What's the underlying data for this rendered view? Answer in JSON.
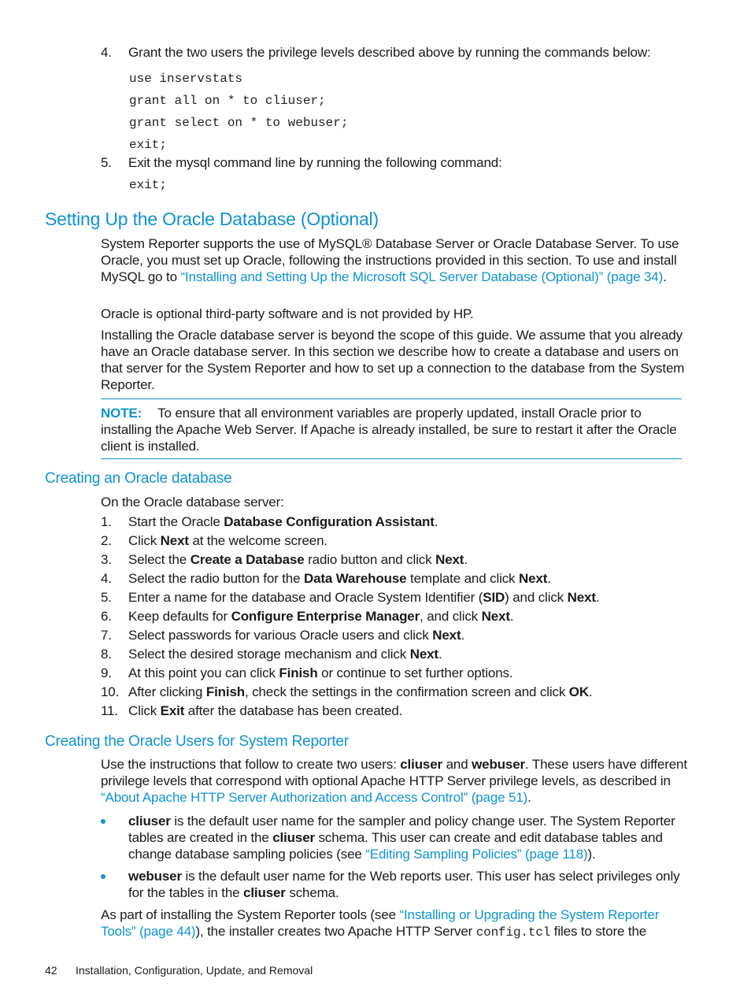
{
  "top_steps": [
    {
      "num": "4.",
      "text": "Grant the two users the privilege levels described above by running the commands below:"
    },
    {
      "num": "5.",
      "text": "Exit the mysql command line by running the following command:"
    }
  ],
  "grant_commands": [
    "use inservstats",
    "grant all on * to cliuser;",
    "grant select on * to webuser;",
    "exit;"
  ],
  "exit_command": "exit;",
  "section_oracle": {
    "title": "Setting Up the Oracle Database (Optional)",
    "intro_p1_a": "System Reporter supports the use of MySQL® Database Server or Oracle Database Server. To use Oracle, you must set up Oracle, following the instructions provided in this section. To use and install MySQL go to ",
    "intro_p1_link": "“Installing and Setting Up the Microsoft SQL Server Database (Optional)” (page 34)",
    "intro_p1_b": ".",
    "intro_p2": "Oracle is optional third-party software and is not provided by HP.",
    "intro_p3": "Installing the Oracle database server is beyond the scope of this guide. We assume that you already have an Oracle database server. In this section we describe how to create a database and users on that server for the System Reporter and how to set up a connection to the database from the System Reporter.",
    "note_label": "NOTE:",
    "note_text": "To ensure that all environment variables are properly updated, install Oracle prior to installing the Apache Web Server. If Apache is already installed, be sure to restart it after the Oracle client is installed."
  },
  "section_create_db": {
    "title": "Creating an Oracle database",
    "lead": "On the Oracle database server:",
    "steps": [
      {
        "num": "1.",
        "parts": [
          [
            "Start the Oracle ",
            false
          ],
          [
            "Database Configuration Assistant",
            true
          ],
          [
            ".",
            false
          ]
        ]
      },
      {
        "num": "2.",
        "parts": [
          [
            "Click ",
            false
          ],
          [
            "Next",
            true
          ],
          [
            " at the welcome screen.",
            false
          ]
        ]
      },
      {
        "num": "3.",
        "parts": [
          [
            "Select the ",
            false
          ],
          [
            "Create a Database",
            true
          ],
          [
            " radio button and click ",
            false
          ],
          [
            "Next",
            true
          ],
          [
            ".",
            false
          ]
        ]
      },
      {
        "num": "4.",
        "parts": [
          [
            "Select the radio button for the ",
            false
          ],
          [
            "Data Warehouse",
            true
          ],
          [
            " template and click ",
            false
          ],
          [
            "Next",
            true
          ],
          [
            ".",
            false
          ]
        ]
      },
      {
        "num": "5.",
        "parts": [
          [
            "Enter a name for the database and Oracle System Identifier (",
            false
          ],
          [
            "SID",
            true
          ],
          [
            ") and click ",
            false
          ],
          [
            "Next",
            true
          ],
          [
            ".",
            false
          ]
        ]
      },
      {
        "num": "6.",
        "parts": [
          [
            "Keep defaults for ",
            false
          ],
          [
            "Configure Enterprise Manager",
            true
          ],
          [
            ", and click ",
            false
          ],
          [
            "Next",
            true
          ],
          [
            ".",
            false
          ]
        ]
      },
      {
        "num": "7.",
        "parts": [
          [
            "Select passwords for various Oracle users and click ",
            false
          ],
          [
            "Next",
            true
          ],
          [
            ".",
            false
          ]
        ]
      },
      {
        "num": "8.",
        "parts": [
          [
            "Select the desired storage mechanism and click ",
            false
          ],
          [
            "Next",
            true
          ],
          [
            ".",
            false
          ]
        ]
      },
      {
        "num": "9.",
        "parts": [
          [
            "At this point you can click ",
            false
          ],
          [
            "Finish",
            true
          ],
          [
            " or continue to set further options.",
            false
          ]
        ]
      },
      {
        "num": "10.",
        "parts": [
          [
            "After clicking ",
            false
          ],
          [
            "Finish",
            true
          ],
          [
            ", check the settings in the confirmation screen and click ",
            false
          ],
          [
            "OK",
            true
          ],
          [
            ".",
            false
          ]
        ]
      },
      {
        "num": "11.",
        "parts": [
          [
            "Click ",
            false
          ],
          [
            "Exit",
            true
          ],
          [
            " after the database has been created.",
            false
          ]
        ]
      }
    ]
  },
  "section_users": {
    "title": "Creating the Oracle Users for System Reporter",
    "p1_a": "Use the instructions that follow to create two users: ",
    "p1_b1": "cliuser",
    "p1_c": " and ",
    "p1_b2": "webuser",
    "p1_d": ". These users have different privilege levels that correspond with optional Apache HTTP Server privilege levels, as described in ",
    "p1_link": "“About Apache HTTP Server Authorization and Access Control” (page 51)",
    "p1_e": ".",
    "bullet1_b": "cliuser",
    "bullet1_a": " is the default user name for the sampler and policy change user. The System Reporter tables are created in the ",
    "bullet1_b2": "cliuser",
    "bullet1_c": " schema. This user can create and edit database tables and change database sampling policies (see ",
    "bullet1_link": "“Editing Sampling Policies” (page 118)",
    "bullet1_d": ").",
    "bullet2_b": "webuser",
    "bullet2_a": " is the default user name for the Web reports user. This user has select privileges only for the tables in the ",
    "bullet2_b2": "cliuser",
    "bullet2_c": " schema.",
    "p2_a": "As part of installing the System Reporter tools (see ",
    "p2_link": "“Installing or Upgrading the System Reporter Tools” (page 44)",
    "p2_b": "), the installer creates two Apache HTTP Server ",
    "p2_code": "config.tcl",
    "p2_c": " files to store the"
  },
  "footer": {
    "page_number": "42",
    "chapter": "Installation, Configuration, Update, and Removal"
  }
}
